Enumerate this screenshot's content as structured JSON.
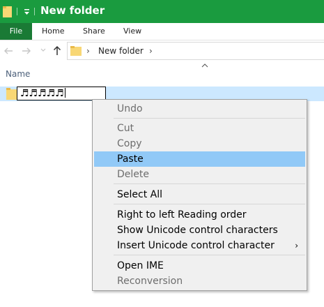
{
  "window": {
    "title": "New folder",
    "accent": "#1a9b3f"
  },
  "ribbon": {
    "tabs": [
      "File",
      "Home",
      "Share",
      "View"
    ]
  },
  "address": {
    "path": "New folder"
  },
  "columns": {
    "name": "Name"
  },
  "file": {
    "name_text": "♬♬♬♬♬"
  },
  "context_menu": {
    "items": [
      {
        "label": "Undo",
        "enabled": false
      },
      {
        "label": "Cut",
        "enabled": false
      },
      {
        "label": "Copy",
        "enabled": false
      },
      {
        "label": "Paste",
        "enabled": true,
        "highlighted": true
      },
      {
        "label": "Delete",
        "enabled": false
      },
      {
        "label": "Select All",
        "enabled": true
      },
      {
        "label": "Right to left Reading order",
        "enabled": true
      },
      {
        "label": "Show Unicode control characters",
        "enabled": true
      },
      {
        "label": "Insert Unicode control character",
        "enabled": true,
        "has_submenu": true
      },
      {
        "label": "Open IME",
        "enabled": true
      },
      {
        "label": "Reconversion",
        "enabled": false
      }
    ]
  }
}
